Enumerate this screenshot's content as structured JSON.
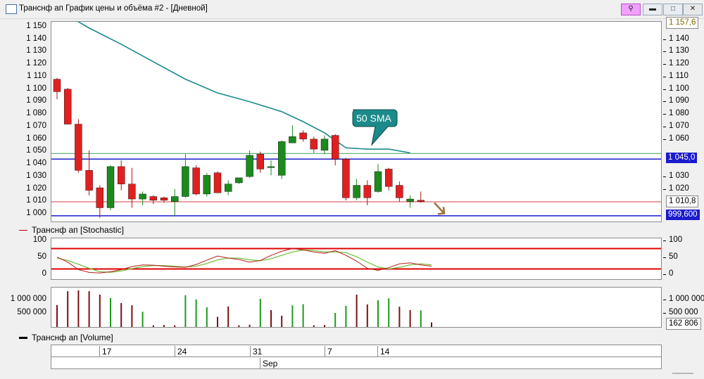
{
  "window": {
    "title": "Транснф ап График цены и объёма #2 - [Дневной]"
  },
  "price_panel": {
    "y_ticks": [
      "1 150",
      "1 140",
      "1 130",
      "1 120",
      "1 110",
      "1 100",
      "1 090",
      "1 080",
      "1 070",
      "1 060",
      "1 050",
      "1 040",
      "1 030",
      "1 020",
      "1 010",
      "1 000"
    ],
    "y_tick_values": [
      1150,
      1140,
      1130,
      1120,
      1110,
      1100,
      1090,
      1080,
      1070,
      1060,
      1050,
      1040,
      1030,
      1020,
      1010,
      1000
    ],
    "right_labels": {
      "top": "1 157,6",
      "blue_line": "1 045,0",
      "red_line": "1 010,8",
      "bottom_line": "999,600"
    },
    "sma_label": "50 SMA"
  },
  "stoch_panel": {
    "legend": "Транснф ап [Stochastic]",
    "y_ticks": [
      "100",
      "50",
      "0"
    ]
  },
  "volume_panel": {
    "legend": "Транснф ап [Volume]",
    "y_ticks_left": [
      "1 000 000",
      "500 000"
    ],
    "y_ticks_right": [
      "1 000 000",
      "500 000"
    ],
    "last_value": "162 806"
  },
  "date_axis": {
    "days": [
      "17",
      "24",
      "31",
      "7",
      "14"
    ],
    "month": "Sep"
  },
  "chart_data": {
    "type": "candlestick",
    "ylim": [
      995,
      1155
    ],
    "candles": [
      {
        "o": 1109,
        "h": 1110,
        "l": 1093,
        "c": 1099
      },
      {
        "o": 1101,
        "h": 1102,
        "l": 1073,
        "c": 1073
      },
      {
        "o": 1073,
        "h": 1077,
        "l": 1034,
        "c": 1036
      },
      {
        "o": 1036,
        "h": 1052,
        "l": 1016,
        "c": 1020
      },
      {
        "o": 1022,
        "h": 1024,
        "l": 998,
        "c": 1006
      },
      {
        "o": 1006,
        "h": 1040,
        "l": 1004,
        "c": 1039
      },
      {
        "o": 1039,
        "h": 1044,
        "l": 1020,
        "c": 1025
      },
      {
        "o": 1025,
        "h": 1038,
        "l": 1006,
        "c": 1013
      },
      {
        "o": 1013,
        "h": 1019,
        "l": 1008,
        "c": 1017
      },
      {
        "o": 1015,
        "h": 1016,
        "l": 1009,
        "c": 1012
      },
      {
        "o": 1014,
        "h": 1015,
        "l": 1010,
        "c": 1012
      },
      {
        "o": 1011,
        "h": 1021,
        "l": 999,
        "c": 1015
      },
      {
        "o": 1015,
        "h": 1049,
        "l": 1014,
        "c": 1039
      },
      {
        "o": 1038,
        "h": 1040,
        "l": 1016,
        "c": 1017
      },
      {
        "o": 1017,
        "h": 1034,
        "l": 1015,
        "c": 1032
      },
      {
        "o": 1034,
        "h": 1035,
        "l": 1018,
        "c": 1018
      },
      {
        "o": 1019,
        "h": 1028,
        "l": 1016,
        "c": 1025
      },
      {
        "o": 1026,
        "h": 1030,
        "l": 1025,
        "c": 1030
      },
      {
        "o": 1031,
        "h": 1052,
        "l": 1030,
        "c": 1048
      },
      {
        "o": 1049,
        "h": 1051,
        "l": 1034,
        "c": 1037
      },
      {
        "o": 1039,
        "h": 1044,
        "l": 1032,
        "c": 1039
      },
      {
        "o": 1032,
        "h": 1060,
        "l": 1029,
        "c": 1059
      },
      {
        "o": 1058,
        "h": 1072,
        "l": 1058,
        "c": 1063
      },
      {
        "o": 1066,
        "h": 1068,
        "l": 1059,
        "c": 1061
      },
      {
        "o": 1061,
        "h": 1063,
        "l": 1050,
        "c": 1053
      },
      {
        "o": 1052,
        "h": 1064,
        "l": 1049,
        "c": 1061
      },
      {
        "o": 1064,
        "h": 1065,
        "l": 1040,
        "c": 1045
      },
      {
        "o": 1045,
        "h": 1046,
        "l": 1012,
        "c": 1014
      },
      {
        "o": 1014,
        "h": 1029,
        "l": 1012,
        "c": 1024
      },
      {
        "o": 1024,
        "h": 1028,
        "l": 1008,
        "c": 1014
      },
      {
        "o": 1019,
        "h": 1041,
        "l": 1018,
        "c": 1035
      },
      {
        "o": 1037,
        "h": 1038,
        "l": 1020,
        "c": 1023
      },
      {
        "o": 1024,
        "h": 1027,
        "l": 1011,
        "c": 1014
      },
      {
        "o": 1011,
        "h": 1016,
        "l": 1006,
        "c": 1013
      },
      {
        "o": 1012,
        "h": 1019,
        "l": 1010,
        "c": 1011
      }
    ],
    "sma": [
      {
        "i": 1,
        "v": 1160
      },
      {
        "i": 3,
        "v": 1150
      },
      {
        "i": 6,
        "v": 1137
      },
      {
        "i": 9,
        "v": 1123
      },
      {
        "i": 12,
        "v": 1109
      },
      {
        "i": 15,
        "v": 1098
      },
      {
        "i": 18,
        "v": 1091
      },
      {
        "i": 21,
        "v": 1083
      },
      {
        "i": 23,
        "v": 1075
      },
      {
        "i": 25,
        "v": 1066
      },
      {
        "i": 27,
        "v": 1054
      },
      {
        "i": 29,
        "v": 1053
      },
      {
        "i": 31,
        "v": 1053
      },
      {
        "i": 33,
        "v": 1050
      }
    ],
    "hlines": [
      {
        "name": "blue_line",
        "v": 1045.0,
        "color": "#1a1acf"
      },
      {
        "name": "red_line",
        "v": 1010.8,
        "color": "#d04040"
      },
      {
        "name": "bottom_line",
        "v": 999.6,
        "color": "#1a1acf"
      },
      {
        "name": "green_line",
        "v": 1049.5,
        "color": "#3aa05a"
      }
    ],
    "stochastic": {
      "ylim": [
        -10,
        110
      ],
      "levels": [
        80,
        20
      ],
      "k": [
        55,
        40,
        18,
        10,
        8,
        12,
        18,
        27,
        32,
        31,
        28,
        26,
        25,
        33,
        46,
        58,
        52,
        48,
        40,
        45,
        60,
        72,
        80,
        76,
        70,
        66,
        74,
        60,
        43,
        22,
        16,
        24,
        35,
        38,
        32,
        28
      ],
      "d": [
        52,
        45,
        34,
        22,
        12,
        10,
        14,
        21,
        27,
        30,
        30,
        28,
        26,
        28,
        36,
        47,
        52,
        52,
        47,
        44,
        50,
        60,
        70,
        76,
        74,
        70,
        70,
        68,
        56,
        40,
        26,
        20,
        25,
        32,
        35,
        32
      ]
    },
    "volume": {
      "ylim": [
        0,
        1400000
      ],
      "values": [
        780000,
        1270000,
        1300000,
        1270000,
        1150000,
        1030000,
        850000,
        770000,
        540000,
        60000,
        70000,
        60000,
        1130000,
        980000,
        700000,
        360000,
        730000,
        60000,
        80000,
        1000000,
        600000,
        400000,
        770000,
        810000,
        60000,
        70000,
        500000,
        750000,
        1150000,
        800000,
        950000,
        1020000,
        720000,
        600000,
        590000,
        162806
      ],
      "colors": [
        "r",
        "r",
        "r",
        "r",
        "r",
        "g",
        "r",
        "r",
        "g",
        "r",
        "r",
        "r",
        "g",
        "g",
        "g",
        "r",
        "r",
        "r",
        "r",
        "g",
        "r",
        "r",
        "g",
        "g",
        "r",
        "r",
        "g",
        "g",
        "r",
        "r",
        "g",
        "g",
        "r",
        "r",
        "g",
        "r"
      ]
    }
  }
}
